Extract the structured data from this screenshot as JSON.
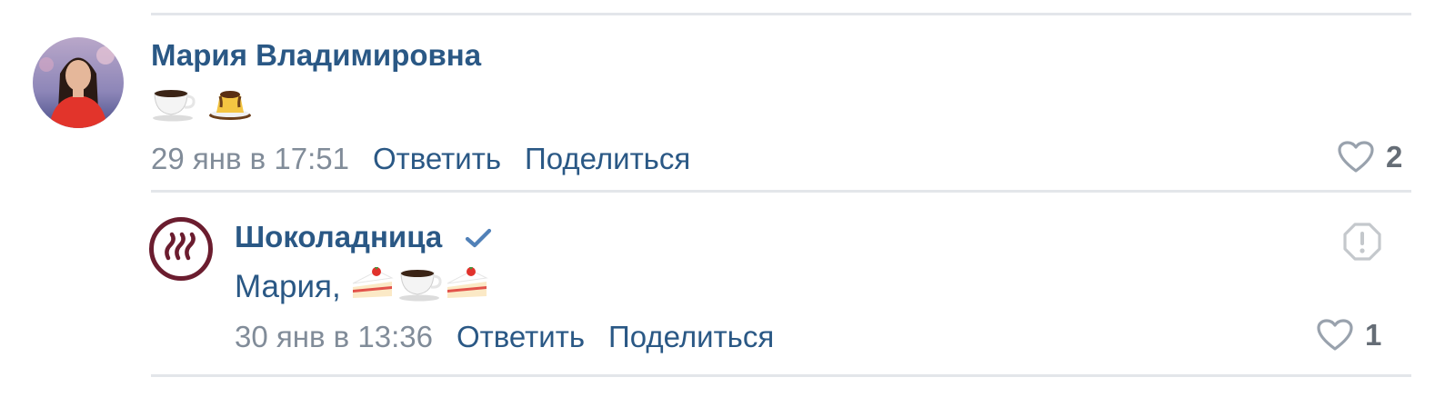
{
  "comments": [
    {
      "author": "Мария Владимировна",
      "emojis": [
        "coffee-cup-emoji",
        "pudding-emoji"
      ],
      "date": "29 янв в 17:51",
      "reply_label": "Ответить",
      "share_label": "Поделиться",
      "likes": "2"
    },
    {
      "author": "Шоколадница",
      "verified": true,
      "text_prefix": "Мария,",
      "emojis": [
        "cake-slice-emoji",
        "coffee-cup-emoji",
        "cake-slice-emoji"
      ],
      "date": "30 янв в 13:36",
      "reply_label": "Ответить",
      "share_label": "Поделиться",
      "likes": "1"
    }
  ],
  "colors": {
    "link": "#2a5885",
    "meta": "#818c99",
    "verified": "#5181b8",
    "divider": "#e3e6ea",
    "brand": "#6b1d2f"
  }
}
